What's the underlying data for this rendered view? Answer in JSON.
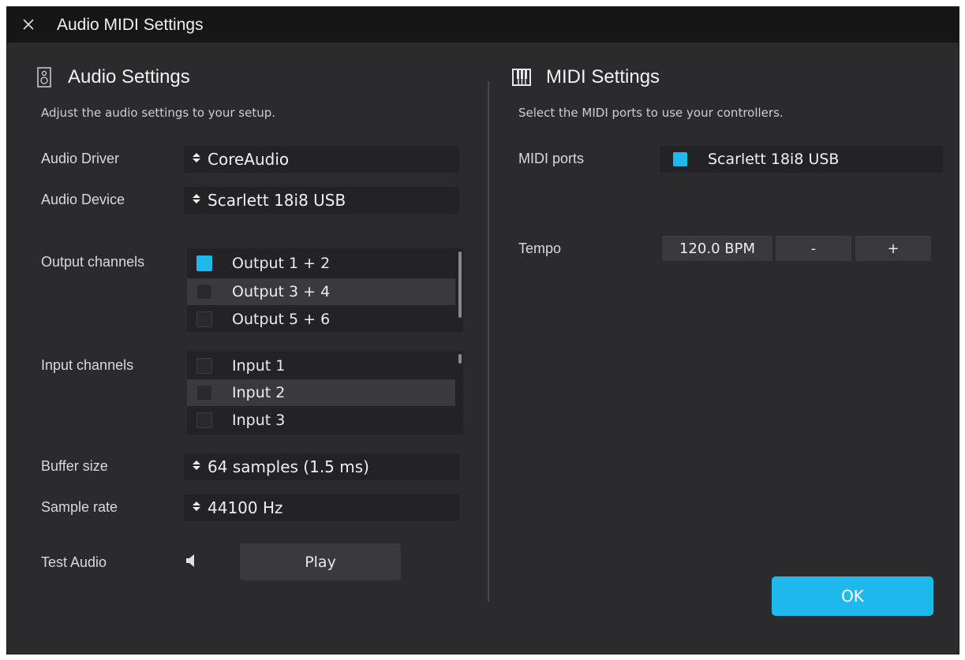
{
  "window": {
    "title": "Audio MIDI Settings"
  },
  "audio": {
    "heading": "Audio Settings",
    "subtitle": "Adjust the audio settings to your setup.",
    "driver": {
      "label": "Audio Driver",
      "value": "CoreAudio"
    },
    "device": {
      "label": "Audio Device",
      "value": "Scarlett 18i8 USB"
    },
    "output_channels": {
      "label": "Output channels",
      "items": [
        {
          "label": "Output 1 + 2",
          "checked": true
        },
        {
          "label": "Output 3 + 4",
          "checked": false
        },
        {
          "label": "Output 5 + 6",
          "checked": false
        }
      ]
    },
    "input_channels": {
      "label": "Input channels",
      "items": [
        {
          "label": "Input 1",
          "checked": false
        },
        {
          "label": "Input 2",
          "checked": false
        },
        {
          "label": "Input 3",
          "checked": false
        }
      ]
    },
    "buffer": {
      "label": "Buffer size",
      "value": "64 samples (1.5 ms)"
    },
    "sample_rate": {
      "label": "Sample rate",
      "value": "44100 Hz"
    },
    "test": {
      "label": "Test Audio",
      "button": "Play"
    }
  },
  "midi": {
    "heading": "MIDI Settings",
    "subtitle": "Select the MIDI ports to use your controllers.",
    "ports": {
      "label": "MIDI ports",
      "value": "Scarlett 18i8 USB",
      "checked": true
    },
    "tempo": {
      "label": "Tempo",
      "value": "120.0 BPM",
      "minus": "-",
      "plus": "+"
    }
  },
  "footer": {
    "ok": "OK"
  },
  "colors": {
    "accent": "#1fb8ec",
    "background": "#2b2b2d",
    "titlebar": "#161617"
  },
  "icons": {
    "close": "close-icon",
    "speaker": "speaker-icon",
    "piano": "piano-icon",
    "updown": "updown-arrows-icon",
    "volume": "volume-icon"
  }
}
